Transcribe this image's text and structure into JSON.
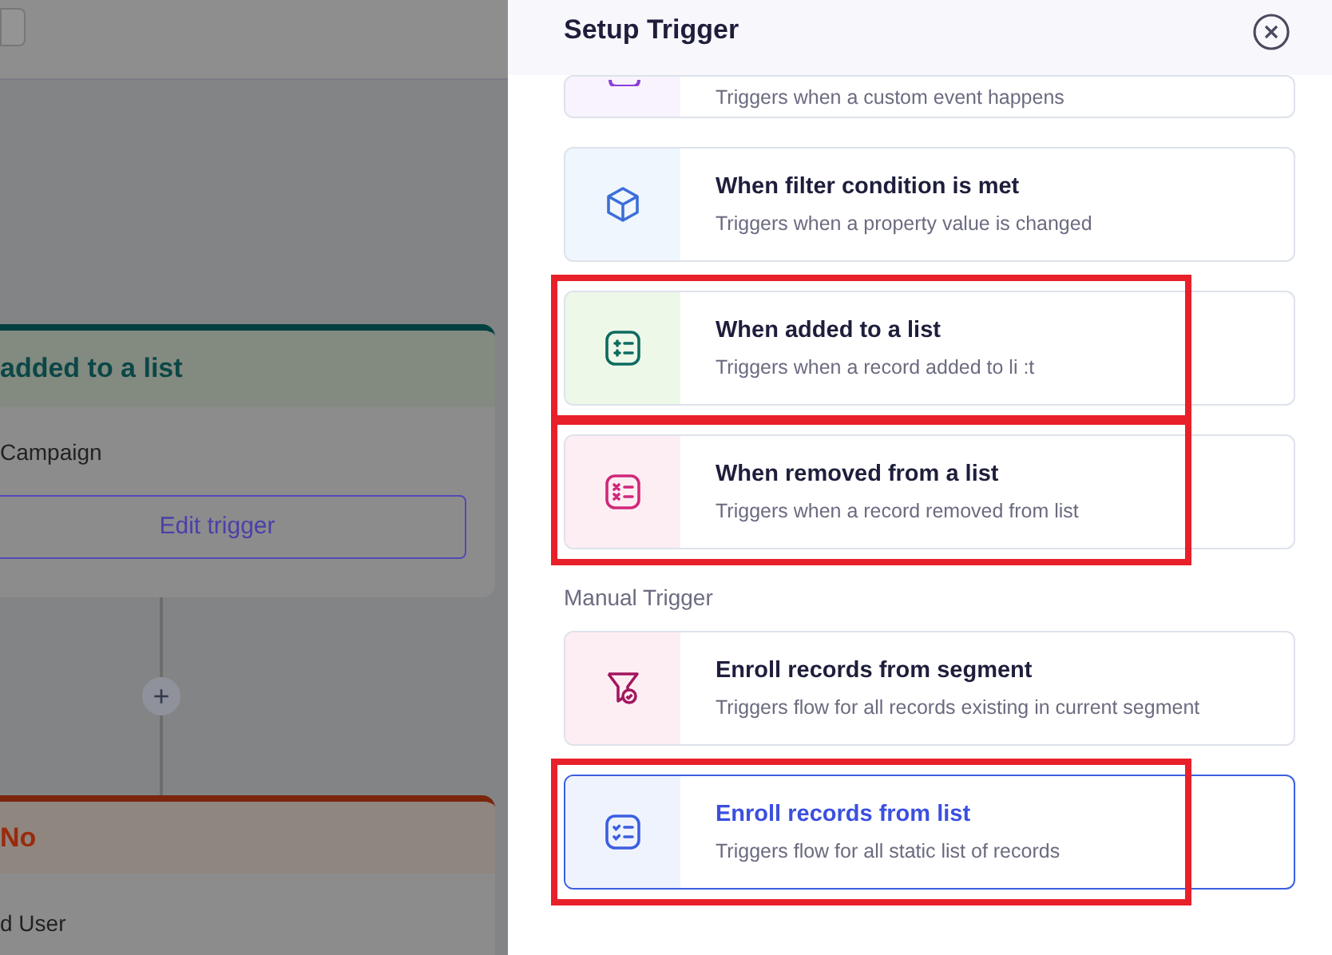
{
  "canvas": {
    "trigger_card": {
      "title": "added to a list",
      "campaign": "Campaign",
      "button": "Edit trigger"
    },
    "add_button": "+",
    "branch_card": {
      "title": "No",
      "body": "d User"
    }
  },
  "panel": {
    "title": "Setup Trigger",
    "items": [
      {
        "kind": "custom",
        "description": "Triggers when a custom event happens",
        "selected": false,
        "highlighted": false
      },
      {
        "kind": "filter",
        "title": "When filter condition is met",
        "description": "Triggers when a property value is changed",
        "selected": false,
        "highlighted": false
      },
      {
        "kind": "added",
        "title": "When added to a list",
        "description": "Triggers when a record added to li :t",
        "selected": false,
        "highlighted": true
      },
      {
        "kind": "removed",
        "title": "When removed from a list",
        "description": "Triggers when a record removed from list",
        "selected": false,
        "highlighted": true
      },
      {
        "kind": "section",
        "title": "Manual Trigger"
      },
      {
        "kind": "segment",
        "title": "Enroll records from segment",
        "description": "Triggers flow for all records existing in current segment",
        "selected": false,
        "highlighted": false
      },
      {
        "kind": "list",
        "title": "Enroll records from list",
        "description": "Triggers flow for all static list of records",
        "selected": true,
        "highlighted": true
      }
    ]
  }
}
